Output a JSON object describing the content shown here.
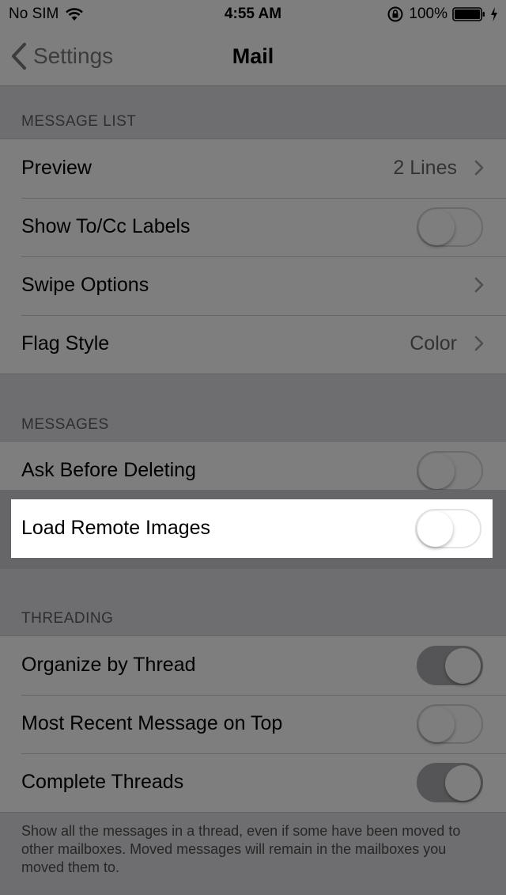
{
  "status_bar": {
    "carrier": "No SIM",
    "time": "4:55 AM",
    "battery": "100%",
    "icons": [
      "wifi-icon",
      "rotation-lock-icon",
      "battery-icon",
      "charging-bolt-icon"
    ]
  },
  "nav": {
    "back_label": "Settings",
    "title": "Mail"
  },
  "sections": {
    "message_list": {
      "header": "MESSAGE LIST",
      "preview_label": "Preview",
      "preview_value": "2 Lines",
      "show_to_cc_label": "Show To/Cc Labels",
      "show_to_cc_on": false,
      "swipe_options_label": "Swipe Options",
      "flag_style_label": "Flag Style",
      "flag_style_value": "Color"
    },
    "messages": {
      "header": "MESSAGES",
      "ask_before_deleting_label": "Ask Before Deleting",
      "ask_before_deleting_on": false,
      "load_remote_images_label": "Load Remote Images",
      "load_remote_images_on": false
    },
    "threading": {
      "header": "THREADING",
      "organize_by_thread_label": "Organize by Thread",
      "organize_by_thread_on": true,
      "most_recent_on_top_label": "Most Recent Message on Top",
      "most_recent_on_top_on": false,
      "complete_threads_label": "Complete Threads",
      "complete_threads_on": true,
      "footer": "Show all the messages in a thread, even if some have been moved to other mailboxes. Moved messages will remain in the mailboxes you moved them to."
    }
  },
  "colors": {
    "overlay_gray": "#7e7e7e",
    "highlight": "#ffffff"
  }
}
